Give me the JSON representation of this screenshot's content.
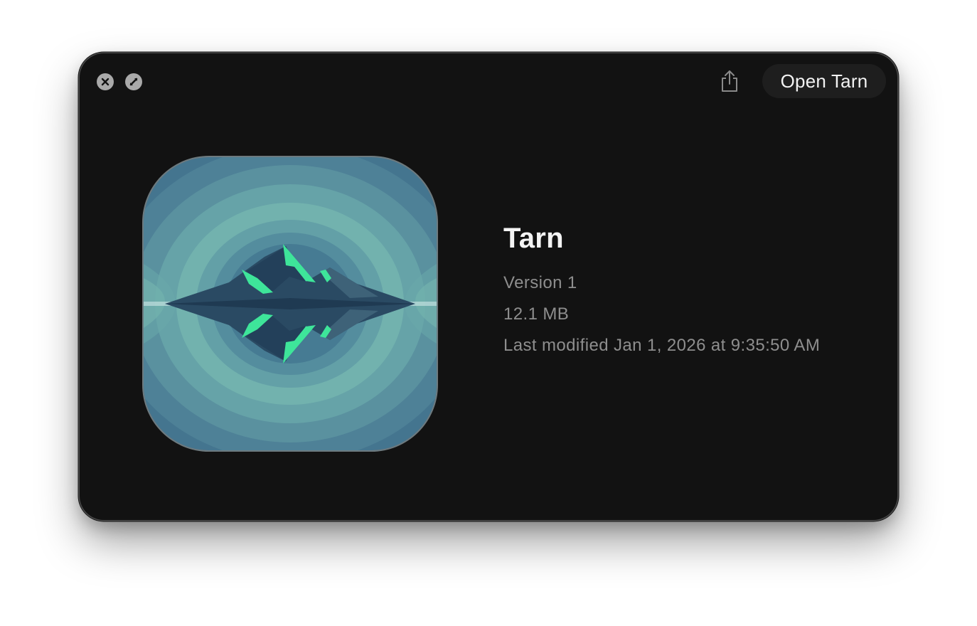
{
  "window": {
    "close_icon": "close-circle-icon",
    "fullscreen_icon": "fullscreen-slash-icon",
    "share_icon": "share-icon",
    "open_button_label": "Open Tarn"
  },
  "app": {
    "name": "Tarn",
    "version": "Version 1",
    "size": "12.1 MB",
    "modified": "Last modified Jan 1, 2026 at 9:35:50 AM",
    "icon": "tarn-mountain-lake-icon"
  },
  "colors": {
    "window_bg": "#121212",
    "icon_teal": "#6fb3b0",
    "icon_blue": "#3f6f8c",
    "accent_green": "#3ee59a"
  }
}
